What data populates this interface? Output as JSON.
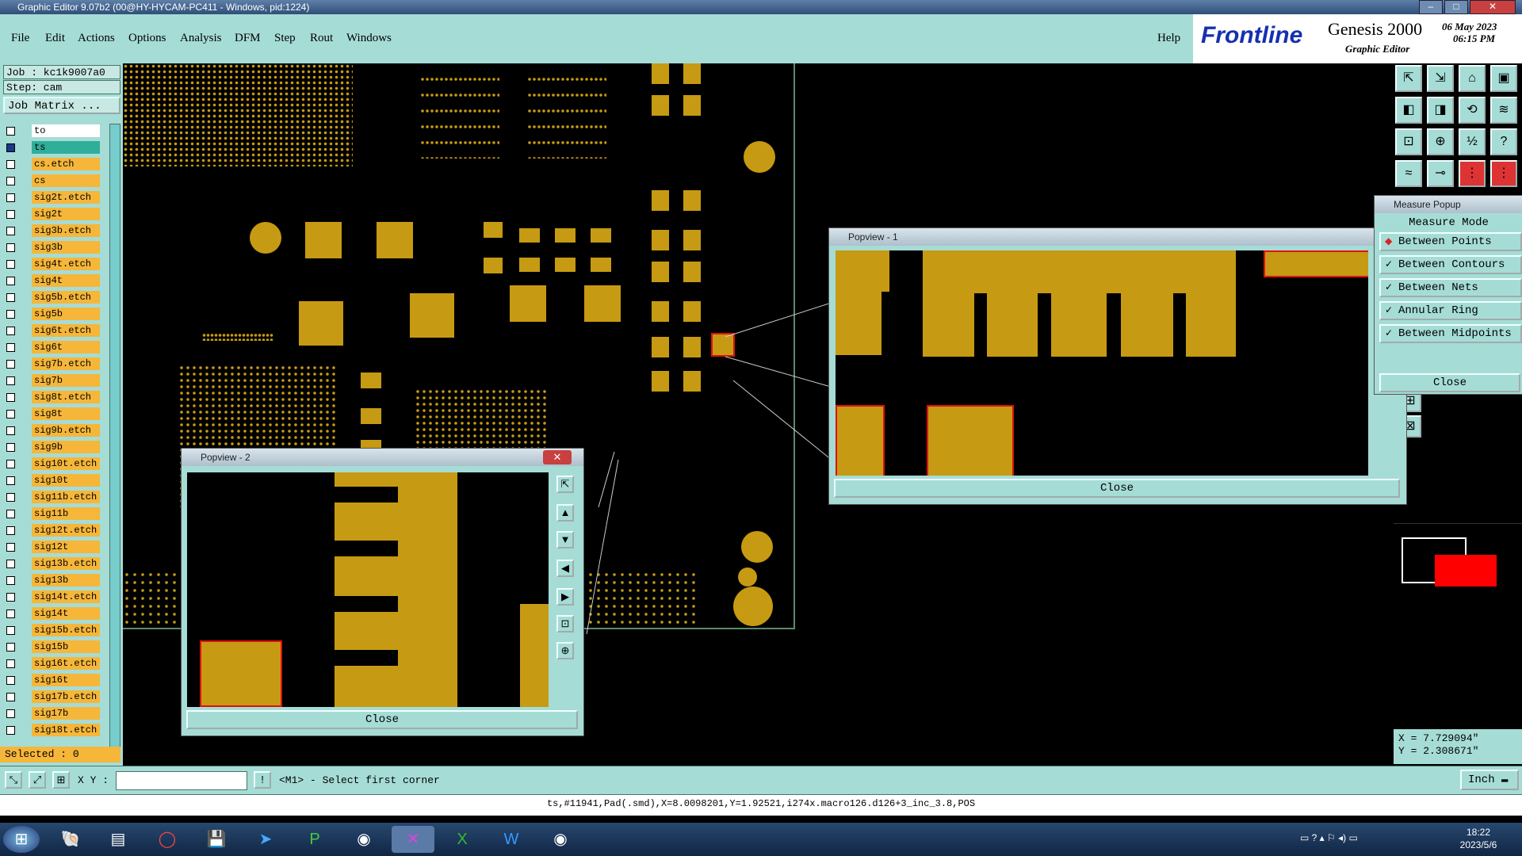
{
  "window": {
    "title": "Graphic Editor 9.07b2 (00@HY-HYCAM-PC411 - Windows, pid:1224)"
  },
  "menu": [
    "File",
    "Edit",
    "Actions",
    "Options",
    "Analysis",
    "DFM",
    "Step",
    "Rout",
    "Windows"
  ],
  "help": "Help",
  "brand": {
    "logo": "Frontline",
    "product": "Genesis 2000",
    "subtitle": "Graphic Editor",
    "date": "06 May 2023",
    "time": "06:15 PM"
  },
  "job": {
    "job_label": "Job : kc1k9007a0",
    "step_label": "Step: cam",
    "matrix_button": "Job Matrix ..."
  },
  "layers": [
    "to",
    "ts",
    "cs.etch",
    "cs",
    "sig2t.etch",
    "sig2t",
    "sig3b.etch",
    "sig3b",
    "sig4t.etch",
    "sig4t",
    "sig5b.etch",
    "sig5b",
    "sig6t.etch",
    "sig6t",
    "sig7b.etch",
    "sig7b",
    "sig8t.etch",
    "sig8t",
    "sig9b.etch",
    "sig9b",
    "sig10t.etch",
    "sig10t",
    "sig11b.etch",
    "sig11b",
    "sig12t.etch",
    "sig12t",
    "sig13b.etch",
    "sig13b",
    "sig14t.etch",
    "sig14t",
    "sig15b.etch",
    "sig15b",
    "sig16t.etch",
    "sig16t",
    "sig17b.etch",
    "sig17b",
    "sig18t.etch"
  ],
  "selected": "Selected : 0",
  "popview1": {
    "title": "Popview - 1",
    "close": "Close"
  },
  "popview2": {
    "title": "Popview - 2",
    "close": "Close"
  },
  "measure": {
    "title": "Measure Popup",
    "mode_header": "Measure Mode",
    "items": [
      "Between Points",
      "Between Contours",
      "Between Nets",
      "Annular Ring",
      "Between Midpoints"
    ],
    "close": "Close"
  },
  "coords": {
    "x": "X = 7.729094\"",
    "y": "Y = 2.308671\""
  },
  "status": {
    "xy_label": "X Y :",
    "xy_value": "",
    "prompt": "<M1> - Select first corner",
    "units": "Inch",
    "info": "ts,#11941,Pad(.smd),X=8.0098201,Y=1.92521,i274x.macro126.d126+3_inc_3.8,POS"
  },
  "clock": {
    "time": "18:22",
    "date": "2023/5/6"
  },
  "colors": {
    "panel": "#a6dcd6",
    "copper": "#c69a12",
    "layer_label": "#f5b63a",
    "highlight": "#e01010"
  }
}
